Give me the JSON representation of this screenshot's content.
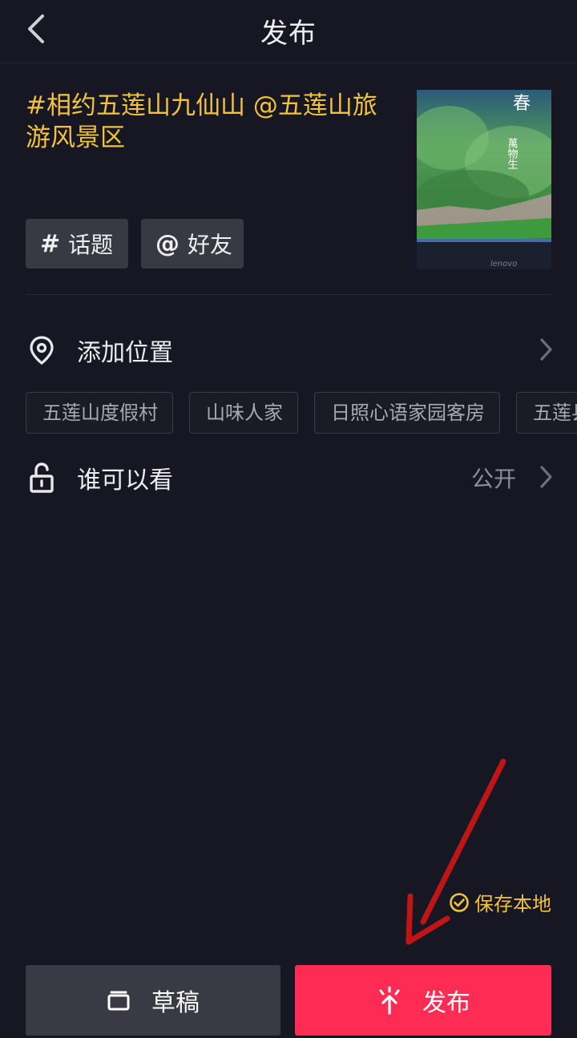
{
  "header": {
    "title": "发布"
  },
  "caption": {
    "text": "#相约五莲山九仙山 @五莲山旅游风景区"
  },
  "cover": {
    "title": "春",
    "subtitle": "萬物生",
    "brand": "lenovo"
  },
  "chips": [
    {
      "symbol": "#",
      "label": "话题"
    },
    {
      "symbol": "@",
      "label": "好友"
    }
  ],
  "location": {
    "label": "添加位置",
    "suggestions": [
      "五莲山度假村",
      "山味人家",
      "日照心语家园客房",
      "五莲县"
    ]
  },
  "visibility": {
    "label": "谁可以看",
    "value": "公开"
  },
  "save_local": {
    "label": "保存本地"
  },
  "buttons": {
    "draft": "草稿",
    "publish": "发布"
  },
  "colors": {
    "accent": "#f2c23a",
    "publish": "#fe2c55",
    "background": "#171723",
    "annotation_arrow": "#d01818"
  }
}
